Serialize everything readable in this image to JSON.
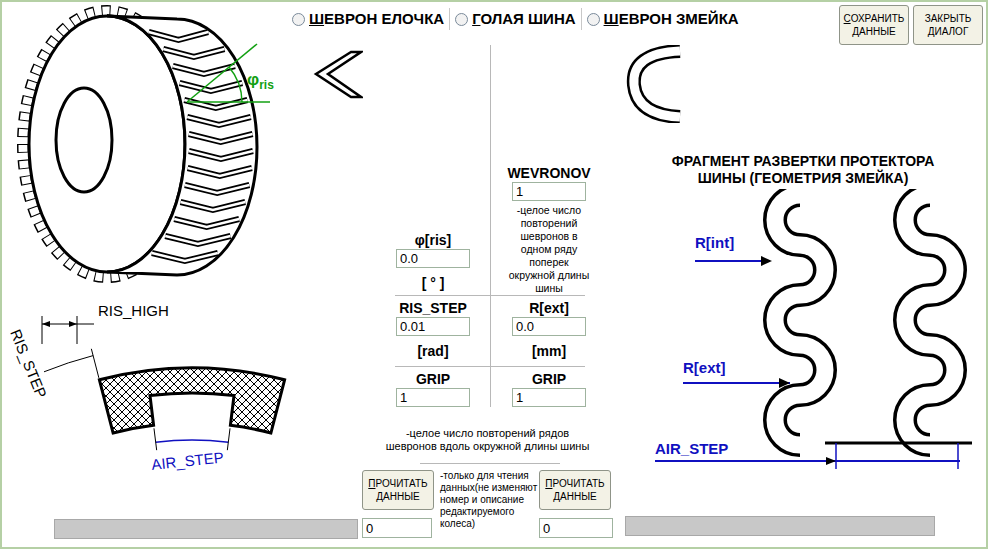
{
  "modes": [
    {
      "label": "ШЕВРОН ЕЛОЧКА",
      "selected": false
    },
    {
      "label": "ГОЛАЯ ШИНА",
      "selected": false
    },
    {
      "label": "ШЕВРОН ЗМЕЙКА",
      "selected": false
    }
  ],
  "top_buttons": [
    {
      "label": "СОХРАНИТЬ ДАННЫЕ",
      "hotkey_first": true
    },
    {
      "label": "ЗАКРЫТЬ ДИАЛОГ",
      "hotkey_first": false
    }
  ],
  "tire_figure": {
    "angle_symbol": "φ",
    "angle_sub": "ris"
  },
  "section_figure": {
    "ris_high": "RIS_HIGH",
    "ris_step": "RIS_STEP",
    "air_step": "AIR_STEP"
  },
  "wevronov": {
    "label": "WEVRONOV",
    "value": "1",
    "note": "-целое число повторений шевронов в одном ряду поперек окружной длины шины"
  },
  "phi_ris": {
    "label": "φ[ris]",
    "value": "0.0",
    "unit": "[ ° ]"
  },
  "ris_step": {
    "label": "RIS_STEP",
    "value": "0.01",
    "unit": "[rad]"
  },
  "r_ext": {
    "label": "R[ext]",
    "value": "0.0",
    "unit": "[mm]"
  },
  "grip": [
    {
      "label": "GRIP",
      "value": "1"
    },
    {
      "label": "GRIP",
      "value": "1"
    }
  ],
  "grip_note": "-целое число повторений рядов шевронов вдоль окружной длины шины",
  "read_buttons": [
    {
      "label": "ПРОЧИТАТЬ ДАННЫЕ",
      "hotkey_first": true
    },
    {
      "label": "ПРОЧИТАТЬ ДАННЫЕ",
      "hotkey_first": true
    }
  ],
  "read_note": "-только для чтения данных(не изменяют номер и описание редактируемого колеса)",
  "status": {
    "left_bar": {
      "value": "",
      "disabled": true
    },
    "left_value": "0",
    "right_value": "0",
    "right_bar": {
      "value": "",
      "disabled": true
    }
  },
  "diagram": {
    "title": "ФРАГМЕНТ РАЗВЕРТКИ ПРОТЕКТОРА ШИНЫ (ГЕОМЕТРИЯ ЗМЕЙКА)",
    "r_int": "R[int]",
    "r_ext": "R[ext]",
    "air_step": "AIR_STEP"
  }
}
